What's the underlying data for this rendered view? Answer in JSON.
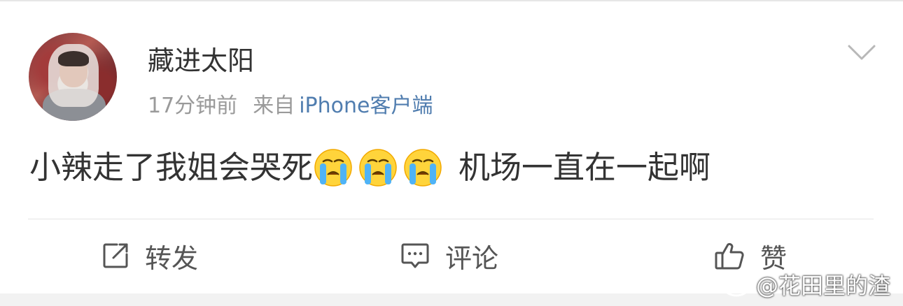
{
  "post": {
    "username": "藏进太阳",
    "time": "17分钟前",
    "from_label": "来自",
    "source": "iPhone客户端",
    "text_before": "小辣走了我姐会哭死",
    "emojis": [
      "crying-emoji",
      "crying-emoji",
      "crying-emoji"
    ],
    "text_after": "机场一直在一起啊"
  },
  "actions": {
    "repost_label": "转发",
    "comment_label": "评论",
    "like_label": "赞"
  },
  "watermark": "@花田里的渣",
  "colors": {
    "text": "#333333",
    "meta": "#9a9a9a",
    "source_link": "#507daf",
    "action": "#555555"
  }
}
